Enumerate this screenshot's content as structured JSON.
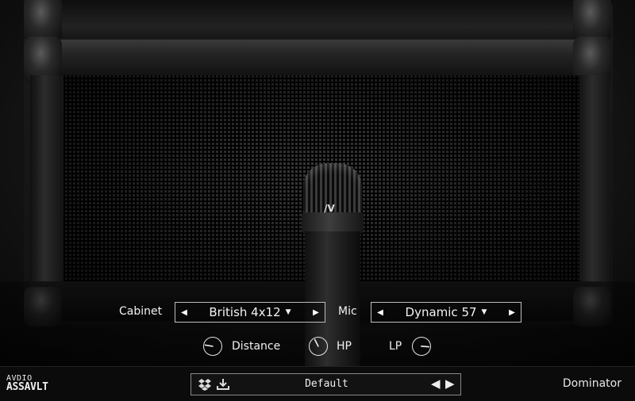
{
  "cabinet": {
    "label": "Cabinet",
    "value": "British 4x12"
  },
  "mic": {
    "label": "Mic",
    "value": "Dynamic 57"
  },
  "knobs": {
    "distance": {
      "label": "Distance",
      "value": 0.2
    },
    "hp": {
      "label": "HP",
      "value": 0.4
    },
    "lp": {
      "label": "LP",
      "value": 0.85
    }
  },
  "footer": {
    "logo_line1": "AVDIO",
    "logo_line2": "ASSAVLT",
    "preset_name": "Default",
    "product_name": "Dominator"
  },
  "mic_logo": "/V",
  "icons": [
    "dropbox-icon",
    "download-icon",
    "prev-preset-icon",
    "next-preset-icon",
    "caret-down-icon"
  ],
  "colors": {
    "background": "#0c0c0c",
    "text": "#f0f0f0",
    "border": "#bdbdbd"
  }
}
